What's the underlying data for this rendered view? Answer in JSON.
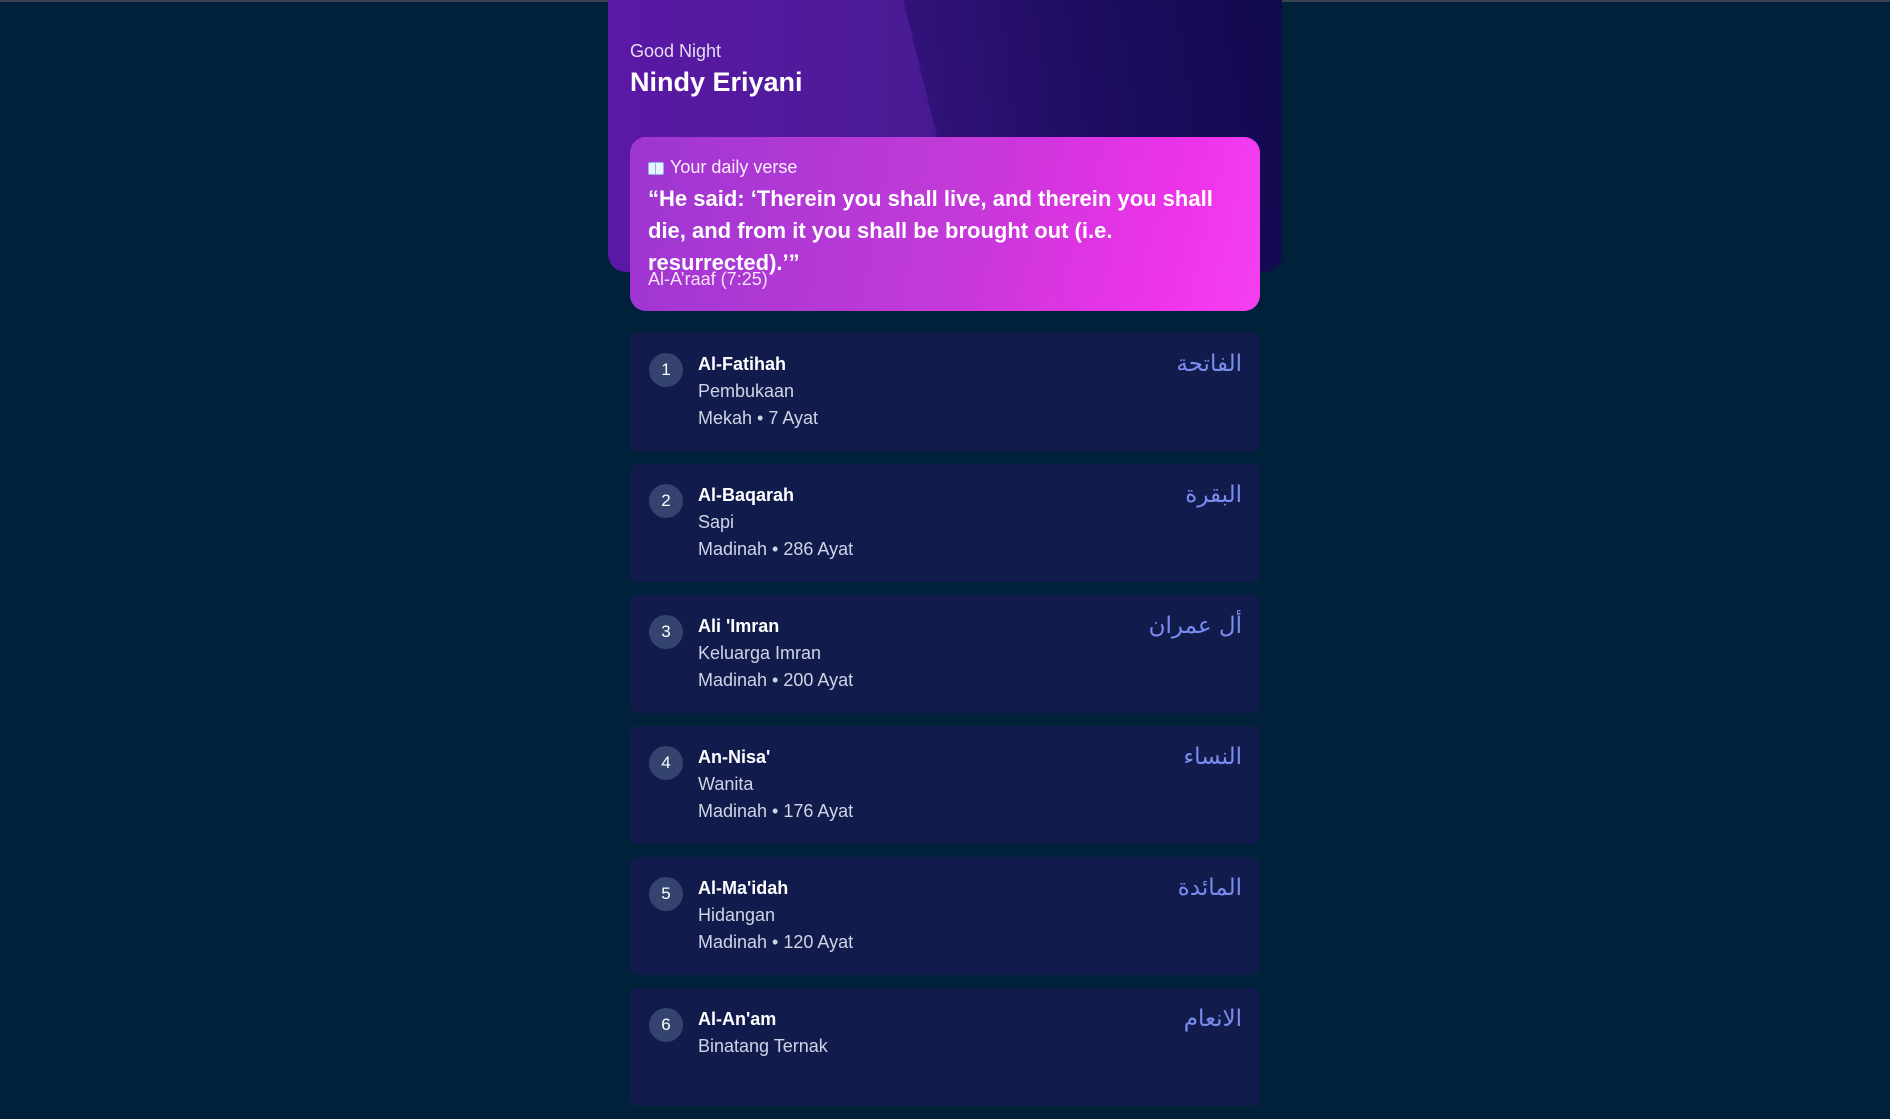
{
  "header": {
    "greeting": "Good Night",
    "username": "Nindy Eriyani"
  },
  "daily_verse": {
    "icon": "book-icon",
    "label": "Your daily verse",
    "text": "“He said: ‘Therein you shall live, and therein you shall die, and from it you shall be brought out (i.e. resurrected).’”",
    "reference": "Al-A’raaf (7:25)"
  },
  "surahs": [
    {
      "number": "1",
      "name": "Al-Fatihah",
      "meaning": "Pembukaan",
      "meta": "Mekah • 7 Ayat",
      "arabic": "الفاتحة"
    },
    {
      "number": "2",
      "name": "Al-Baqarah",
      "meaning": "Sapi",
      "meta": "Madinah • 286 Ayat",
      "arabic": "البقرة"
    },
    {
      "number": "3",
      "name": "Ali 'Imran",
      "meaning": "Keluarga Imran",
      "meta": "Madinah • 200 Ayat",
      "arabic": "أل عمران"
    },
    {
      "number": "4",
      "name": "An-Nisa'",
      "meaning": "Wanita",
      "meta": "Madinah • 176 Ayat",
      "arabic": "النساء"
    },
    {
      "number": "5",
      "name": "Al-Ma'idah",
      "meaning": "Hidangan",
      "meta": "Madinah • 120 Ayat",
      "arabic": "المائدة"
    },
    {
      "number": "6",
      "name": "Al-An'am",
      "meaning": "Binatang Ternak",
      "meta": "",
      "arabic": "الانعام"
    }
  ],
  "colors": {
    "background": "#01203a",
    "card": "#121c4c",
    "accent_arabic": "#7b8cf0",
    "verse_gradient_end": "#f232ef"
  }
}
